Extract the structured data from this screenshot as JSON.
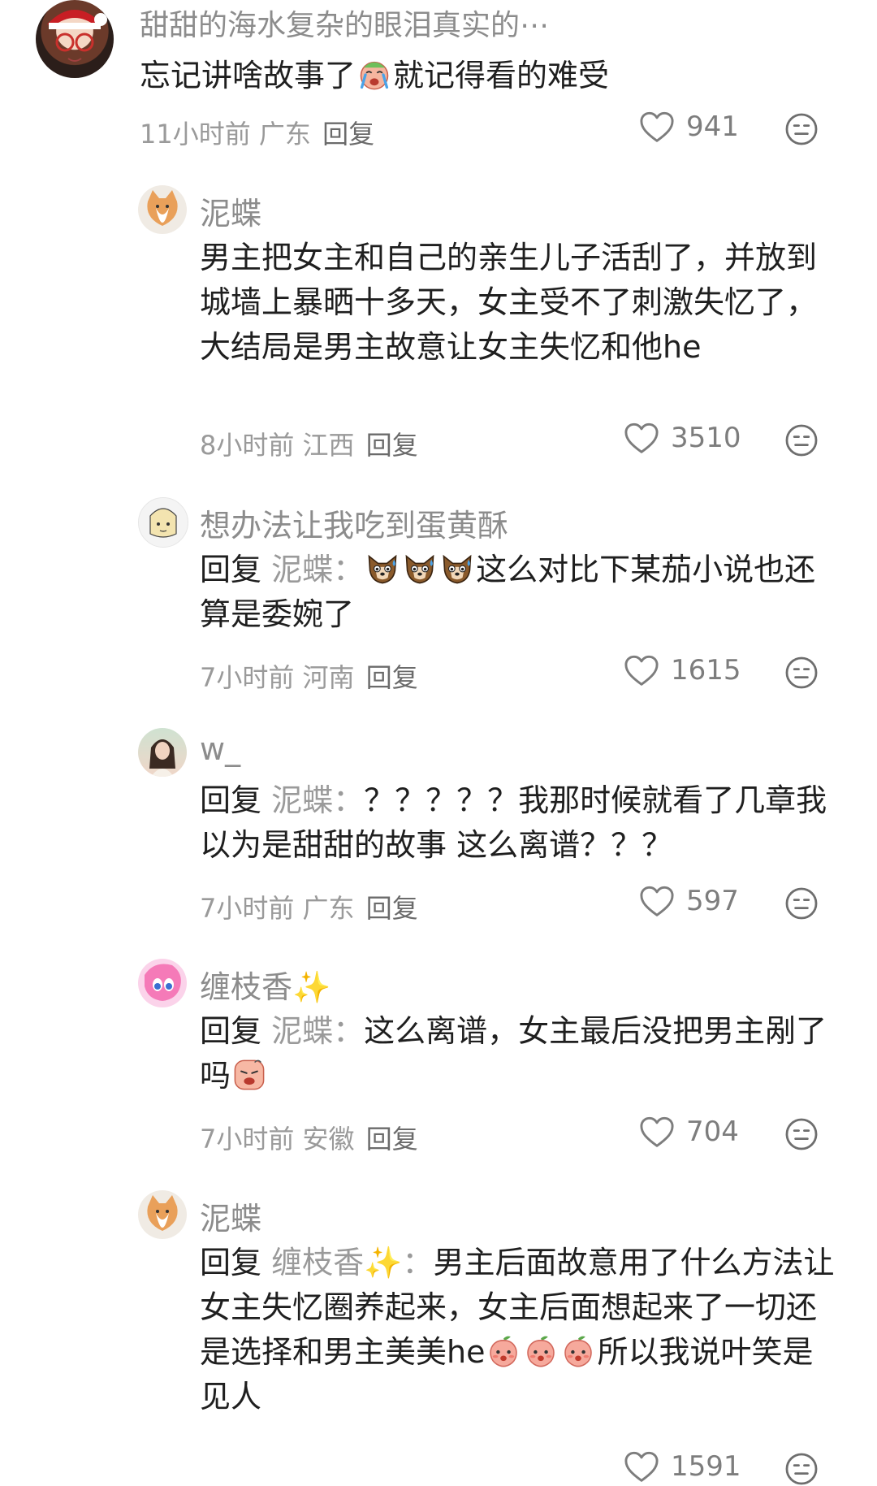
{
  "comments": [
    {
      "username": "甜甜的海水复杂的眼泪真实的⋯",
      "text_a": "忘记讲啥故事了",
      "emoji_a": "crying-face-emoji",
      "text_b": "就记得看的难受",
      "time": "11小时前",
      "location": "广东",
      "reply_label": "回复",
      "likes": "941"
    },
    {
      "username": "泥蝶",
      "text": "男主把女主和自己的亲生儿子活刮了，并放到城墙上暴晒十多天，女主受不了刺激失忆了，大结局是男主故意让女主失忆和他he",
      "time": "8小时前",
      "location": "江西",
      "reply_label": "回复",
      "likes": "3510"
    },
    {
      "username": "想办法让我吃到蛋黄酥",
      "reply_prefix": "回复",
      "reply_target": "泥蝶：",
      "emoji": "sweating-dog-emoji",
      "text": "这么对比下某茄小说也还算是委婉了",
      "time": "7小时前",
      "location": "河南",
      "reply_label": "回复",
      "likes": "1615"
    },
    {
      "username": "w_",
      "reply_prefix": "回复",
      "reply_target": "泥蝶：",
      "text": "？？？？？我那时候就看了几章我以为是甜甜的故事 这么离谱？？？",
      "time": "7小时前",
      "location": "广东",
      "reply_label": "回复",
      "likes": "597"
    },
    {
      "username": "缠枝香✨",
      "reply_prefix": "回复",
      "reply_target": "泥蝶：",
      "text": "这么离谱，女主最后没把男主剐了吗",
      "emoji": "annoyed-face-emoji",
      "time": "7小时前",
      "location": "安徽",
      "reply_label": "回复",
      "likes": "704"
    },
    {
      "username": "泥蝶",
      "reply_prefix": "回复",
      "reply_target": "缠枝香✨：",
      "text_a": "男主后面故意用了什么方法让女主失忆圈养起来，女主后面想起来了一切还是选择和男主美美he",
      "emoji": "peach-face-emoji",
      "text_b": "所以我说叶笑是见人",
      "likes": "1591"
    }
  ],
  "colors": {
    "text": "#1f1f1f",
    "meta": "#9a9a9a",
    "username": "#8c8c8c",
    "icon": "#7d7d7d"
  }
}
